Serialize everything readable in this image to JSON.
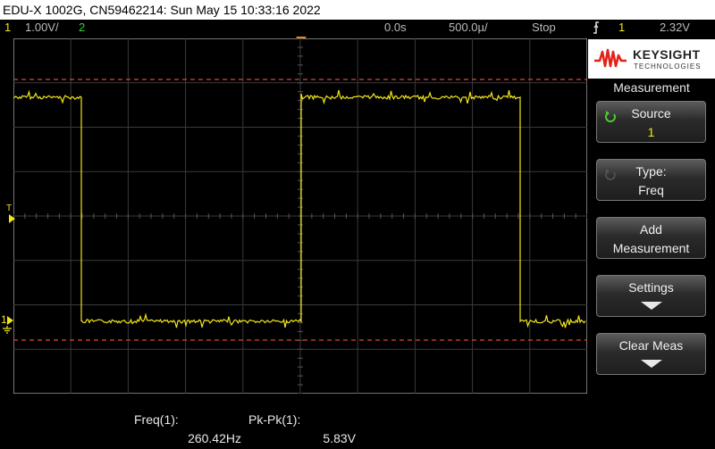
{
  "title": "EDU-X 1002G, CN59462214: Sun May 15 10:33:16 2022",
  "status": {
    "ch1_num": "1",
    "ch1_scale": "1.00V/",
    "ch2_num": "2",
    "time_offset": "0.0s",
    "time_scale": "500.0µ/",
    "run_state": "Stop",
    "trigger_icon": "trigger-edge-icon",
    "trigger_channel": "1",
    "trigger_level": "2.32V"
  },
  "waveform": {
    "channel": "1",
    "trigger_marker": "T",
    "ground_marker": "1",
    "colors": {
      "trace": "#f2e61a",
      "cursor": "#e0443c",
      "grid": "#3a3a3a"
    }
  },
  "brand": {
    "name": "KEYSIGHT",
    "sub": "TECHNOLOGIES"
  },
  "menu": {
    "title": "Measurement",
    "source_label": "Source",
    "source_value": "1",
    "type_label": "Type:",
    "type_value": "Freq",
    "add_label1": "Add",
    "add_label2": "Measurement",
    "settings_label": "Settings",
    "clear_label": "Clear Meas"
  },
  "measurements": [
    {
      "label": "Freq(1):",
      "value": "260.42Hz"
    },
    {
      "label": "Pk-Pk(1):",
      "value": "5.83V"
    }
  ]
}
